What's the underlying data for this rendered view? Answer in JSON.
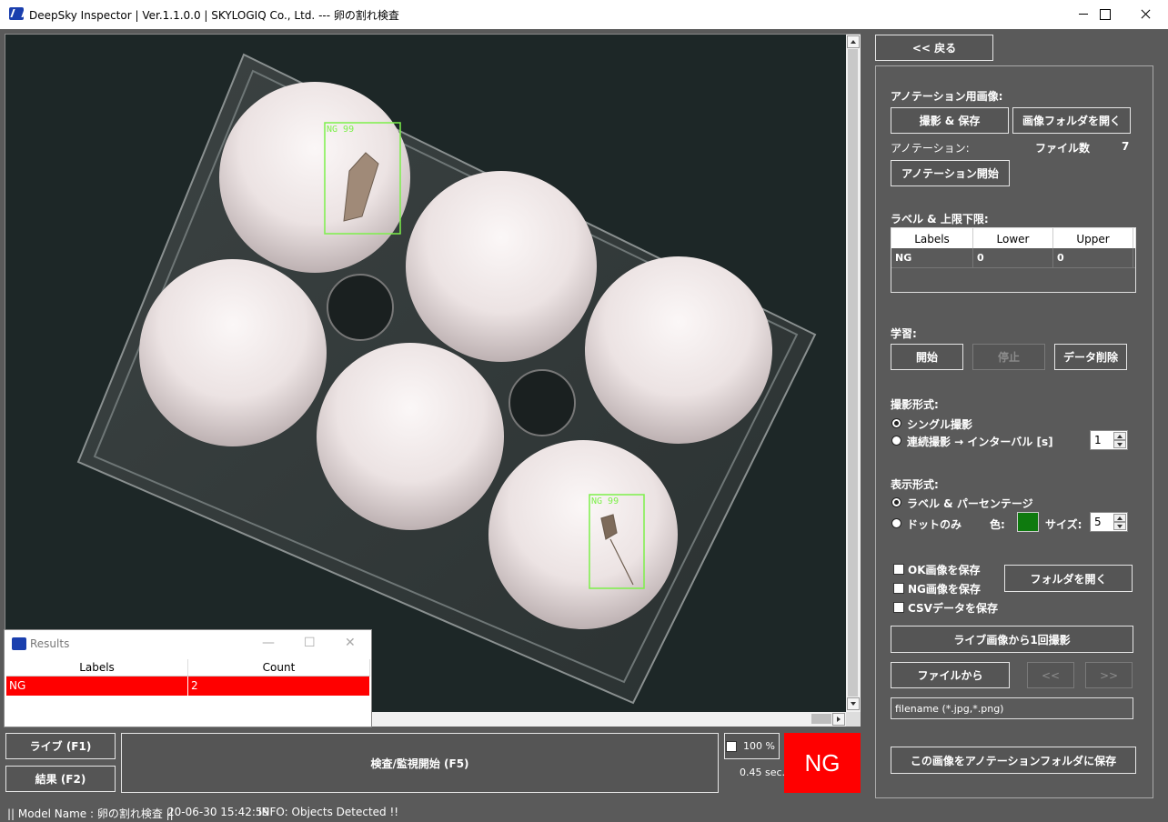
{
  "window": {
    "title": "DeepSky Inspector | Ver.1.1.0.0 | SKYLOGIQ Co., Ltd. --- 卵の割れ検査"
  },
  "detections": [
    {
      "label": "NG 99"
    },
    {
      "label": "NG 99"
    }
  ],
  "results": {
    "title": "Results",
    "columns": [
      "Labels",
      "Count"
    ],
    "rows": [
      {
        "label": "NG",
        "count": "2"
      }
    ]
  },
  "controls": {
    "live_button": "ライブ (F1)",
    "result_button": "結果 (F2)",
    "inspect_button": "検査/監視開始 (F5)",
    "zoom_value": "100 %",
    "time_value": "0.45 sec.",
    "verdict": "NG"
  },
  "panel": {
    "back_button": "<< 戻る",
    "annotation_image_heading": "アノテーション用画像:",
    "capture_save_button": "撮影 & 保存",
    "open_image_folder_button": "画像フォルダを開く",
    "annotation_label": "アノテーション:",
    "file_count_label": "ファイル数",
    "file_count_value": "7",
    "annotation_start_button": "アノテーション開始",
    "label_limits_heading": "ラベル & 上限下限:",
    "label_table": {
      "columns": [
        "Labels",
        "Lower",
        "Upper"
      ],
      "rows": [
        {
          "label": "NG",
          "lower": "0",
          "upper": "0"
        }
      ]
    },
    "learning_heading": "学習:",
    "start_button": "開始",
    "stop_button": "停止",
    "delete_data_button": "データ削除",
    "capture_mode_heading": "撮影形式:",
    "single_capture_label": "シングル撮影",
    "continuous_capture_label": "連続撮影 → インターバル [s]",
    "interval_value": "1",
    "display_mode_heading": "表示形式:",
    "label_percentage_label": "ラベル & パーセンテージ",
    "dot_only_label": "ドットのみ",
    "color_label": "色:",
    "dot_color": "#0e7a0e",
    "size_label": "サイズ:",
    "size_value": "5",
    "save_ok_label": "OK画像を保存",
    "save_ng_label": "NG画像を保存",
    "save_csv_label": "CSVデータを保存",
    "open_folder_button": "フォルダを開く",
    "capture_from_live_button": "ライブ画像から1回撮影",
    "from_file_button": "ファイルから",
    "prev_button": "<<",
    "next_button": ">>",
    "filename_value": "filename (*.jpg,*.png)",
    "save_to_annotation_button": "この画像をアノテーションフォルダに保存"
  },
  "status": {
    "model": "|| Model Name : 卵の割れ検査 ||",
    "timestamp": "20-06-30 15:42:59",
    "info": "INFO:  Objects Detected !!"
  },
  "colors": {
    "verdict_bg": "#ff0000",
    "detection_box": "#7df04a",
    "panel_bg": "#5a5a5a"
  }
}
